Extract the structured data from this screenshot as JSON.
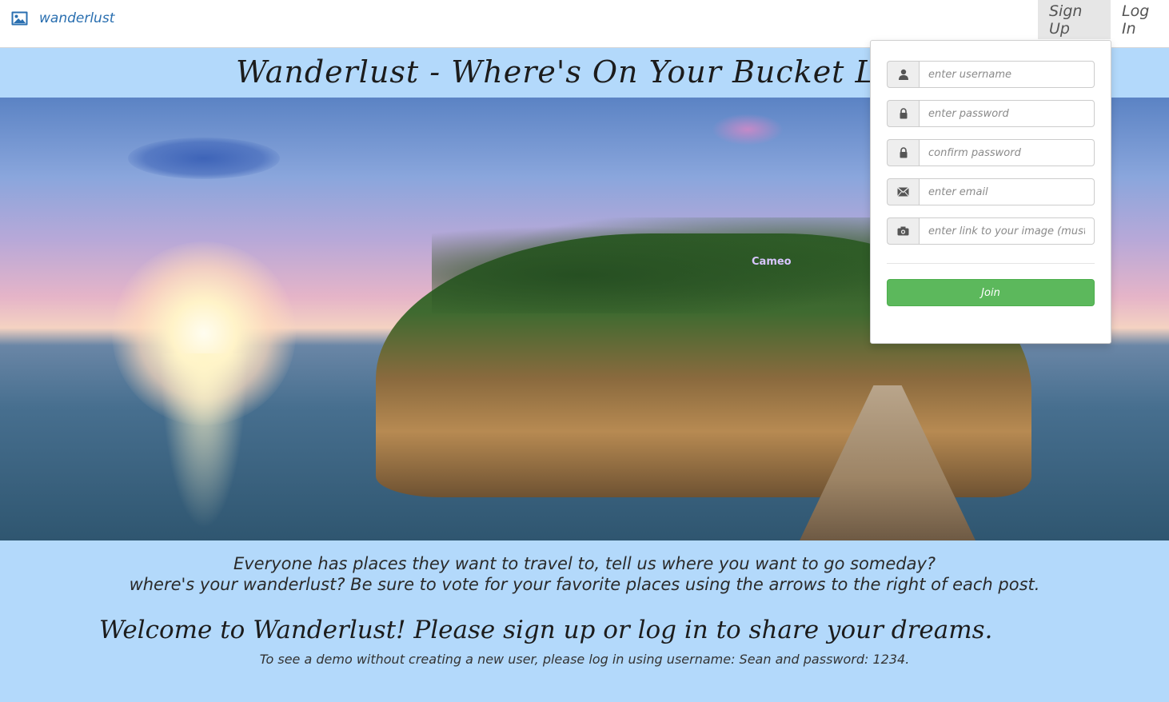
{
  "navbar": {
    "brand": "wanderlust",
    "signup_label": "Sign Up",
    "login_label": "Log In"
  },
  "hero": {
    "title": "Wanderlust - Where's On Your Bucket List?",
    "sign_text": "Cameo"
  },
  "intro": {
    "line1": "Everyone has places they want to travel to, tell us where you want to go someday?",
    "line2": "where's your wanderlust? Be sure to vote for your favorite places using the arrows to the right of each post."
  },
  "welcome": "Welcome to Wanderlust! Please sign up or log in to share your dreams.",
  "demo_note": "To see a demo without creating a new user, please log in using username: Sean and password: 1234.",
  "signup_form": {
    "fields": [
      {
        "icon": "user-icon",
        "placeholder": "enter username",
        "value": ""
      },
      {
        "icon": "lock-icon",
        "placeholder": "enter password",
        "value": ""
      },
      {
        "icon": "lock-icon",
        "placeholder": "confirm password",
        "value": ""
      },
      {
        "icon": "envelope-icon",
        "placeholder": "enter email",
        "value": ""
      },
      {
        "icon": "camera-icon",
        "placeholder": "enter link to your image (must end in .jpg, .png, .gif)",
        "value": ""
      }
    ],
    "join_label": "Join"
  },
  "colors": {
    "page_background": "#b3d9fb",
    "brand_link": "#2a6fb0",
    "join_button": "#5cb85c"
  }
}
